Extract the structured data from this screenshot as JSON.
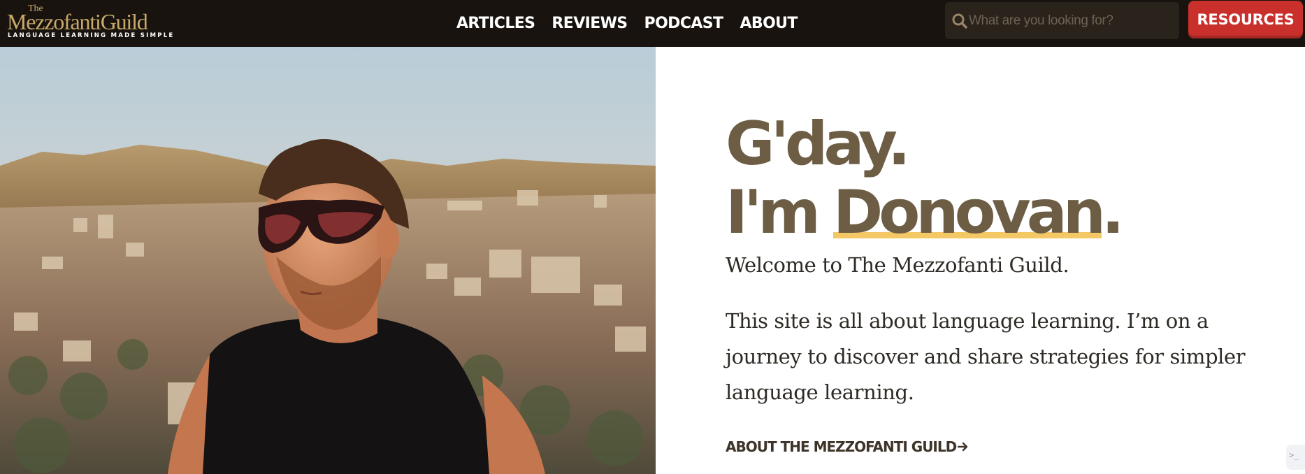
{
  "brand": {
    "logo_top": "The",
    "logo_name": "MezzofantiGuild",
    "tagline": "LANGUAGE LEARNING MADE SIMPLE"
  },
  "nav": {
    "items": [
      {
        "label": "ARTICLES"
      },
      {
        "label": "REVIEWS"
      },
      {
        "label": "PODCAST"
      },
      {
        "label": "ABOUT"
      }
    ]
  },
  "search": {
    "placeholder": "What are you looking for?",
    "icon": "search-icon"
  },
  "resources_button": {
    "label": "RESOURCES"
  },
  "hero": {
    "headline_line1": "G'day.",
    "headline_prefix": "I'm ",
    "headline_name": "Donovan",
    "headline_suffix": ".",
    "welcome": "Welcome to The Mezzofanti Guild.",
    "body": "This site is all about language learning. I’m on a journey to discover and share strategies for simpler language learning.",
    "cta_label": "ABOUT THE MEZZOFANTI GUILD",
    "cta_icon": "arrow-right-icon"
  },
  "colors": {
    "header_bg": "#18130e",
    "brand_gold": "#c9a96a",
    "headline": "#6d5d44",
    "underline": "#f4c864",
    "resources_bg": "#c9302c"
  }
}
